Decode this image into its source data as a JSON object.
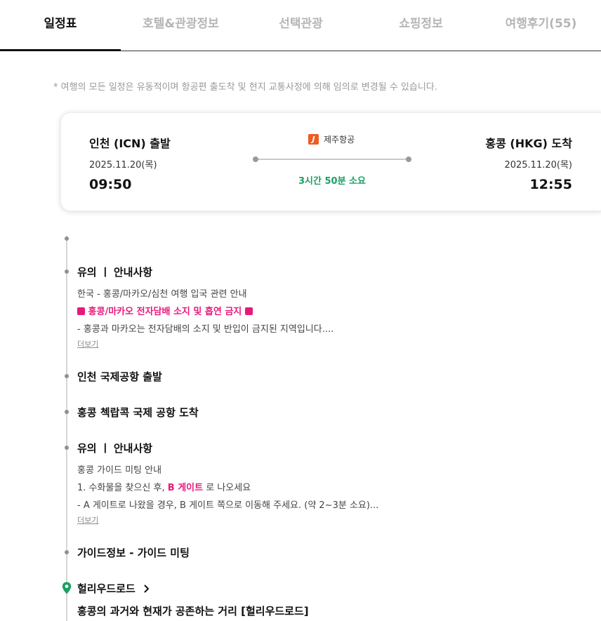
{
  "tabs": [
    {
      "label": "일정표",
      "active": true
    },
    {
      "label": "호텔&관광정보",
      "active": false
    },
    {
      "label": "선택관광",
      "active": false
    },
    {
      "label": "쇼핑정보",
      "active": false
    },
    {
      "label": "여행후기(55)",
      "active": false
    }
  ],
  "notice": "* 여행의 모든 일정은 유동적이며 항공편 출도착 및 현지 교통사정에 의해 임의로 변경될 수 있습니다.",
  "flight": {
    "airline": "제주항공",
    "airline_logo_letter": "J",
    "departure": {
      "city": "인천 (ICN) 출발",
      "date": "2025.11.20(목)",
      "time": "09:50"
    },
    "arrival": {
      "city": "홍콩 (HKG) 도착",
      "date": "2025.11.20(목)",
      "time": "12:55"
    },
    "duration": "3시간 50분 소요"
  },
  "timeline": {
    "notice1": {
      "title": "유의 ㅣ 안내사항",
      "subtitle": "한국 - 홍콩/마카오/심천 여행 입국 관련 안내",
      "highlight": "홍콩/마카오 전자담배 소지 및 흡연 금지",
      "desc": "- 홍콩과 마카오는 전자담배의 소지 및 반입이 금지된 지역입니다....",
      "more": "더보기"
    },
    "depart": "인천 국제공항 출발",
    "arrive": "홍콩 첵랍콕 국제 공항 도착",
    "notice2": {
      "title": "유의 ㅣ 안내사항",
      "subtitle": "홍콩 가이드 미팅 안내",
      "line_prefix": "1. 수화물을 찾으신 후,",
      "line_highlight": "B 게이트",
      "line_suffix": "로 나오세요",
      "desc": "- A 게이트로 나왔을 경우, B 게이트 쪽으로 이동해 주세요. (약 2~3분 소요)...",
      "more": "더보기"
    },
    "guide": "가이드정보 - 가이드 미팅",
    "place": {
      "name": "헐리우드로드",
      "desc": "홍콩의 과거와 현재가 공존하는 거리 [헐리우드로드]"
    }
  },
  "colors": {
    "accent_green": "#1aa163",
    "highlight_pink": "#e8187a",
    "airline_orange": "#f15a22"
  }
}
